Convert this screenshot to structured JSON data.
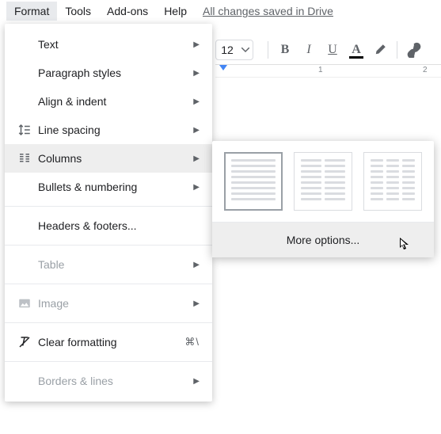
{
  "menubar": {
    "format": "Format",
    "tools": "Tools",
    "addons": "Add-ons",
    "help": "Help",
    "saved": "All changes saved in Drive"
  },
  "toolbar": {
    "fontsize": "12",
    "bold": "B",
    "italic": "I",
    "underline": "U",
    "textcolor": "A"
  },
  "ruler": {
    "n1": "1",
    "n2": "2"
  },
  "format_menu": {
    "text": "Text",
    "paragraph_styles": "Paragraph styles",
    "align_indent": "Align & indent",
    "line_spacing": "Line spacing",
    "columns": "Columns",
    "bullets_numbering": "Bullets & numbering",
    "headers_footers": "Headers & footers...",
    "table": "Table",
    "image": "Image",
    "clear_formatting": "Clear formatting",
    "clear_shortcut": "⌘\\",
    "borders_lines": "Borders & lines"
  },
  "columns_submenu": {
    "more_options": "More options..."
  }
}
